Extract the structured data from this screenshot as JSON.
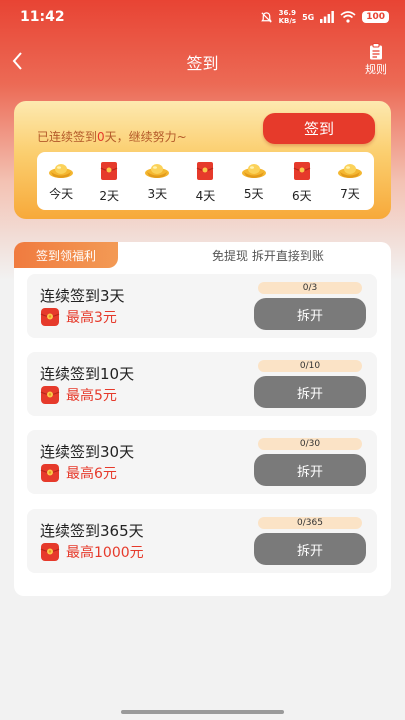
{
  "status_bar": {
    "time": "11:42",
    "net_speed_value": "36.9",
    "net_speed_unit": "KB/s",
    "network": "5G",
    "battery": "100"
  },
  "nav": {
    "title": "签到",
    "rules_label": "规则"
  },
  "signin": {
    "text_prefix": "已连续签到",
    "days_count": "0",
    "text_suffix": "天，继续努力~",
    "button_label": "签到",
    "days": [
      {
        "label": "今天",
        "icon": "gold-ingot-icon"
      },
      {
        "label": "2天",
        "icon": "red-packet-icon"
      },
      {
        "label": "3天",
        "icon": "gold-ingot-icon"
      },
      {
        "label": "4天",
        "icon": "red-packet-icon"
      },
      {
        "label": "5天",
        "icon": "gold-ingot-icon"
      },
      {
        "label": "6天",
        "icon": "red-packet-icon"
      },
      {
        "label": "7天",
        "icon": "gold-ingot-icon"
      }
    ]
  },
  "benefits": {
    "tab_label": "签到领福利",
    "note": "免提现  拆开直接到账",
    "tasks": [
      {
        "title": "连续签到3天",
        "reward": "最高3元",
        "progress_text": "0/3",
        "progress_fraction": 0,
        "button_label": "拆开"
      },
      {
        "title": "连续签到10天",
        "reward": "最高5元",
        "progress_text": "0/10",
        "progress_fraction": 0,
        "button_label": "拆开"
      },
      {
        "title": "连续签到30天",
        "reward": "最高6元",
        "progress_text": "0/30",
        "progress_fraction": 0,
        "button_label": "拆开"
      },
      {
        "title": "连续签到365天",
        "reward": "最高1000元",
        "progress_text": "0/365",
        "progress_fraction": 0,
        "button_label": "拆开"
      }
    ]
  },
  "colors": {
    "accent_red": "#e63a2b",
    "button_gray": "#7a7a7a",
    "tab_orange": "#f07b3f"
  }
}
